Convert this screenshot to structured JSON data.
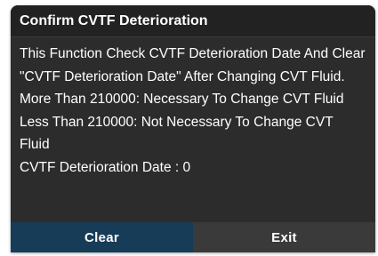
{
  "dialog": {
    "title": "Confirm CVTF Deterioration",
    "lines": [
      "This Function Check CVTF Deterioration Date And Clear \"CVTF Deterioration Date\" After Changing CVT Fluid.",
      "More Than 210000: Necessary To Change CVT Fluid",
      "Less Than 210000: Not Necessary To Change CVT Fluid",
      "CVTF Deterioration Date : 0"
    ],
    "buttons": {
      "clear_label": "Clear",
      "exit_label": "Exit"
    }
  },
  "colors": {
    "dialog_bg": "#2c2c2c",
    "title_bg": "#222222",
    "primary_button": "#163c57",
    "secondary_button": "#3a3a3a",
    "text": "#ffffff"
  }
}
